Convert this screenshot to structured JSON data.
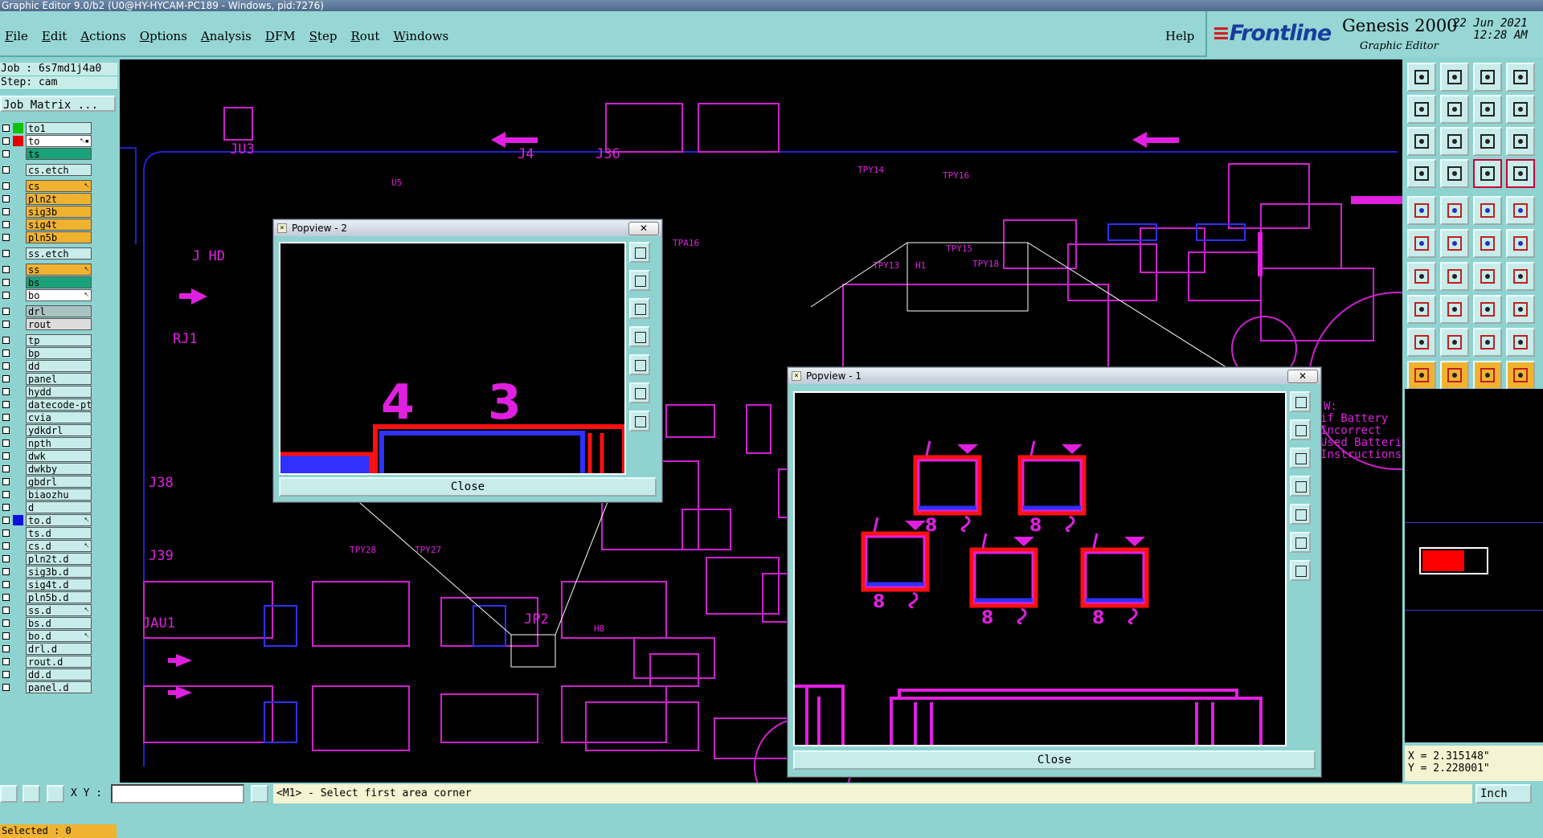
{
  "window": {
    "title": "Graphic Editor 9.0/b2 (U0@HY-HYCAM-PC189 - Windows, pid:7276)"
  },
  "menu": [
    "File",
    "Edit",
    "Actions",
    "Options",
    "Analysis",
    "DFM",
    "Step",
    "Rout",
    "Windows"
  ],
  "help_label": "Help",
  "brand": {
    "logo_mark": "≡",
    "logo_text": "Frontline",
    "product": "Genesis 2000",
    "subtitle": "Graphic Editor",
    "date": "22 Jun 2021",
    "time": "12:28 AM"
  },
  "job": {
    "job_line": "Job : 6s7md1j4a0",
    "step_line": "Step: cam",
    "matrix_button": "Job Matrix ..."
  },
  "layers": [
    {
      "name": "to1",
      "color": "#10c010",
      "bg": "#c8ecea",
      "mark": "",
      "gap": false
    },
    {
      "name": "to",
      "color": "#e00000",
      "bg": "#ffffff",
      "mark": "⭦▪",
      "gap": false
    },
    {
      "name": "ts",
      "color": "",
      "bg": "#1aa37a",
      "mark": "",
      "gap": false
    },
    {
      "name": "cs.etch",
      "color": "",
      "bg": "#c8ecea",
      "mark": "",
      "gap": true
    },
    {
      "name": "cs",
      "color": "",
      "bg": "#f0b330",
      "mark": "⭦",
      "gap": true
    },
    {
      "name": "pln2t",
      "color": "",
      "bg": "#f0b330",
      "mark": "",
      "gap": false
    },
    {
      "name": "sig3b",
      "color": "",
      "bg": "#f0b330",
      "mark": "",
      "gap": false
    },
    {
      "name": "sig4t",
      "color": "",
      "bg": "#f0b330",
      "mark": "",
      "gap": false
    },
    {
      "name": "pln5b",
      "color": "",
      "bg": "#f0b330",
      "mark": "",
      "gap": false
    },
    {
      "name": "ss.etch",
      "color": "",
      "bg": "#c8ecea",
      "mark": "",
      "gap": true
    },
    {
      "name": "ss",
      "color": "",
      "bg": "#f0b330",
      "mark": "⭦",
      "gap": true
    },
    {
      "name": "bs",
      "color": "",
      "bg": "#1aa37a",
      "mark": "",
      "gap": false
    },
    {
      "name": "bo",
      "color": "",
      "bg": "#ffffff",
      "mark": "⭦",
      "gap": false
    },
    {
      "name": "drl",
      "color": "",
      "bg": "#a9c3c3",
      "mark": "",
      "gap": true
    },
    {
      "name": "rout",
      "color": "",
      "bg": "#dcdcdc",
      "mark": "",
      "gap": false
    },
    {
      "name": "tp",
      "color": "",
      "bg": "#c8ecea",
      "mark": "",
      "gap": true
    },
    {
      "name": "bp",
      "color": "",
      "bg": "#c8ecea",
      "mark": "",
      "gap": false
    },
    {
      "name": "dd",
      "color": "",
      "bg": "#c8ecea",
      "mark": "",
      "gap": false
    },
    {
      "name": "panel",
      "color": "",
      "bg": "#c8ecea",
      "mark": "",
      "gap": false
    },
    {
      "name": "hydd",
      "color": "",
      "bg": "#c8ecea",
      "mark": "",
      "gap": false
    },
    {
      "name": "datecode-pto",
      "color": "",
      "bg": "#c8ecea",
      "mark": "",
      "gap": false
    },
    {
      "name": "cvia",
      "color": "",
      "bg": "#c8ecea",
      "mark": "",
      "gap": false
    },
    {
      "name": "ydkdrl",
      "color": "",
      "bg": "#c8ecea",
      "mark": "",
      "gap": false
    },
    {
      "name": "npth",
      "color": "",
      "bg": "#c8ecea",
      "mark": "",
      "gap": false
    },
    {
      "name": "dwk",
      "color": "",
      "bg": "#c8ecea",
      "mark": "",
      "gap": false
    },
    {
      "name": "dwkby",
      "color": "",
      "bg": "#c8ecea",
      "mark": "",
      "gap": false
    },
    {
      "name": "gbdrl",
      "color": "",
      "bg": "#c8ecea",
      "mark": "",
      "gap": false
    },
    {
      "name": "biaozhu",
      "color": "",
      "bg": "#c8ecea",
      "mark": "",
      "gap": false
    },
    {
      "name": "d",
      "color": "",
      "bg": "#c8ecea",
      "mark": "",
      "gap": false
    },
    {
      "name": "to.d",
      "color": "#1010e0",
      "bg": "#c8ecea",
      "mark": "⭦",
      "gap": false
    },
    {
      "name": "ts.d",
      "color": "",
      "bg": "#c8ecea",
      "mark": "",
      "gap": false
    },
    {
      "name": "cs.d",
      "color": "",
      "bg": "#c8ecea",
      "mark": "⭦",
      "gap": false
    },
    {
      "name": "pln2t.d",
      "color": "",
      "bg": "#c8ecea",
      "mark": "",
      "gap": false
    },
    {
      "name": "sig3b.d",
      "color": "",
      "bg": "#c8ecea",
      "mark": "",
      "gap": false
    },
    {
      "name": "sig4t.d",
      "color": "",
      "bg": "#c8ecea",
      "mark": "",
      "gap": false
    },
    {
      "name": "pln5b.d",
      "color": "",
      "bg": "#c8ecea",
      "mark": "",
      "gap": false
    },
    {
      "name": "ss.d",
      "color": "",
      "bg": "#c8ecea",
      "mark": "⭦",
      "gap": false
    },
    {
      "name": "bs.d",
      "color": "",
      "bg": "#c8ecea",
      "mark": "",
      "gap": false
    },
    {
      "name": "bo.d",
      "color": "",
      "bg": "#c8ecea",
      "mark": "⭦",
      "gap": false
    },
    {
      "name": "drl.d",
      "color": "",
      "bg": "#c8ecea",
      "mark": "",
      "gap": false
    },
    {
      "name": "rout.d",
      "color": "",
      "bg": "#c8ecea",
      "mark": "",
      "gap": false
    },
    {
      "name": "dd.d",
      "color": "",
      "bg": "#c8ecea",
      "mark": "",
      "gap": false
    },
    {
      "name": "panel.d",
      "color": "",
      "bg": "#c8ecea",
      "mark": "",
      "gap": false
    }
  ],
  "selected": "Selected : 0",
  "canvas": {
    "labels": [
      "JU3",
      "J4",
      "J36",
      "J HD",
      "RJ1",
      "J38",
      "J39",
      "JAU1",
      "JP2",
      "H8",
      "TPA16",
      "TPY14",
      "TPY16",
      "TPY13",
      "TPY15",
      "TPY18",
      "H1",
      "TPY28",
      "TPY27",
      "U5"
    ],
    "note_lines": [
      "W:",
      "if Battery",
      "Incorrect",
      "Used Batteri",
      "Instructions"
    ]
  },
  "popview2": {
    "title": "Popview - 2",
    "close_x": "✕",
    "close": "Close",
    "digits": [
      "4",
      "3"
    ]
  },
  "popview1": {
    "title": "Popview - 1",
    "close_x": "✕",
    "close": "Close"
  },
  "coords": {
    "x": "X = 2.315148\"",
    "y": "Y = 2.228001\""
  },
  "status": {
    "xy_label": "X Y :",
    "input_value": "",
    "message": "<M1> - Select first area corner",
    "unit": "Inch"
  },
  "colors": {
    "magenta": "#e020e0",
    "red": "#ff1010",
    "blue": "#2020ff",
    "panel": "#8fd3d1"
  }
}
